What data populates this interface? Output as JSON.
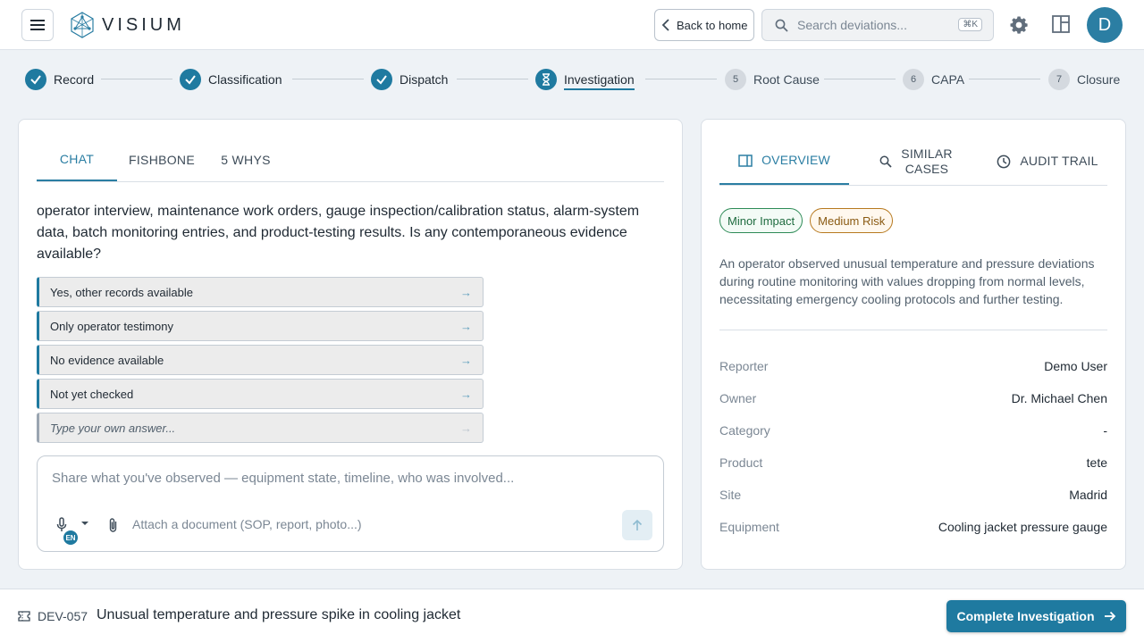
{
  "header": {
    "app_name": "VISIUM",
    "back_label": "Back to home",
    "search_placeholder": "Search deviations...",
    "search_shortcut": "⌘K",
    "avatar_initial": "D"
  },
  "stepper": {
    "steps": [
      {
        "number": "1",
        "label": "Record",
        "state": "done"
      },
      {
        "number": "2",
        "label": "Classification",
        "state": "done"
      },
      {
        "number": "3",
        "label": "Dispatch",
        "state": "done"
      },
      {
        "number": "4",
        "label": "Investigation",
        "state": "active"
      },
      {
        "number": "5",
        "label": "Root Cause",
        "state": "todo"
      },
      {
        "number": "6",
        "label": "CAPA",
        "state": "todo"
      },
      {
        "number": "7",
        "label": "Closure",
        "state": "todo"
      }
    ]
  },
  "left": {
    "tabs": [
      "CHAT",
      "FISHBONE",
      "5 WHYS"
    ],
    "question": "operator interview, maintenance work orders, gauge inspection/calibration status, alarm-system data, batch monitoring entries, and product-testing results. Is any contemporaneous evidence available?",
    "options": [
      "Yes, other records available",
      "Only operator testimony",
      "No evidence available",
      "Not yet checked"
    ],
    "custom_option": "Type your own answer...",
    "composer": {
      "placeholder": "Share what you've observed — equipment state, timeline, who was involved...",
      "lang": "EN",
      "attach_label": "Attach a document (SOP, report, photo...)"
    }
  },
  "right": {
    "tabs": {
      "overview": "OVERVIEW",
      "similar_line1": "SIMILAR",
      "similar_line2": "CASES",
      "audit": "AUDIT TRAIL"
    },
    "badges": {
      "impact": "Minor Impact",
      "risk": "Medium Risk"
    },
    "description": "An operator observed unusual temperature and pressure deviations during routine monitoring with values dropping from normal levels, necessitating emergency cooling protocols and further testing.",
    "meta": [
      {
        "key": "Reporter",
        "value": "Demo User"
      },
      {
        "key": "Owner",
        "value": "Dr. Michael Chen"
      },
      {
        "key": "Category",
        "value": "-"
      },
      {
        "key": "Product",
        "value": "tete"
      },
      {
        "key": "Site",
        "value": "Madrid"
      },
      {
        "key": "Equipment",
        "value": "Cooling jacket pressure gauge"
      }
    ]
  },
  "footer": {
    "deviation_id": "DEV-057",
    "deviation_title": "Unusual temperature and pressure spike in cooling jacket",
    "complete_label": "Complete Investigation"
  },
  "colors": {
    "accent": "#1f7aa0",
    "minor_impact": "#2e8b57",
    "medium_risk": "#b7791f"
  }
}
